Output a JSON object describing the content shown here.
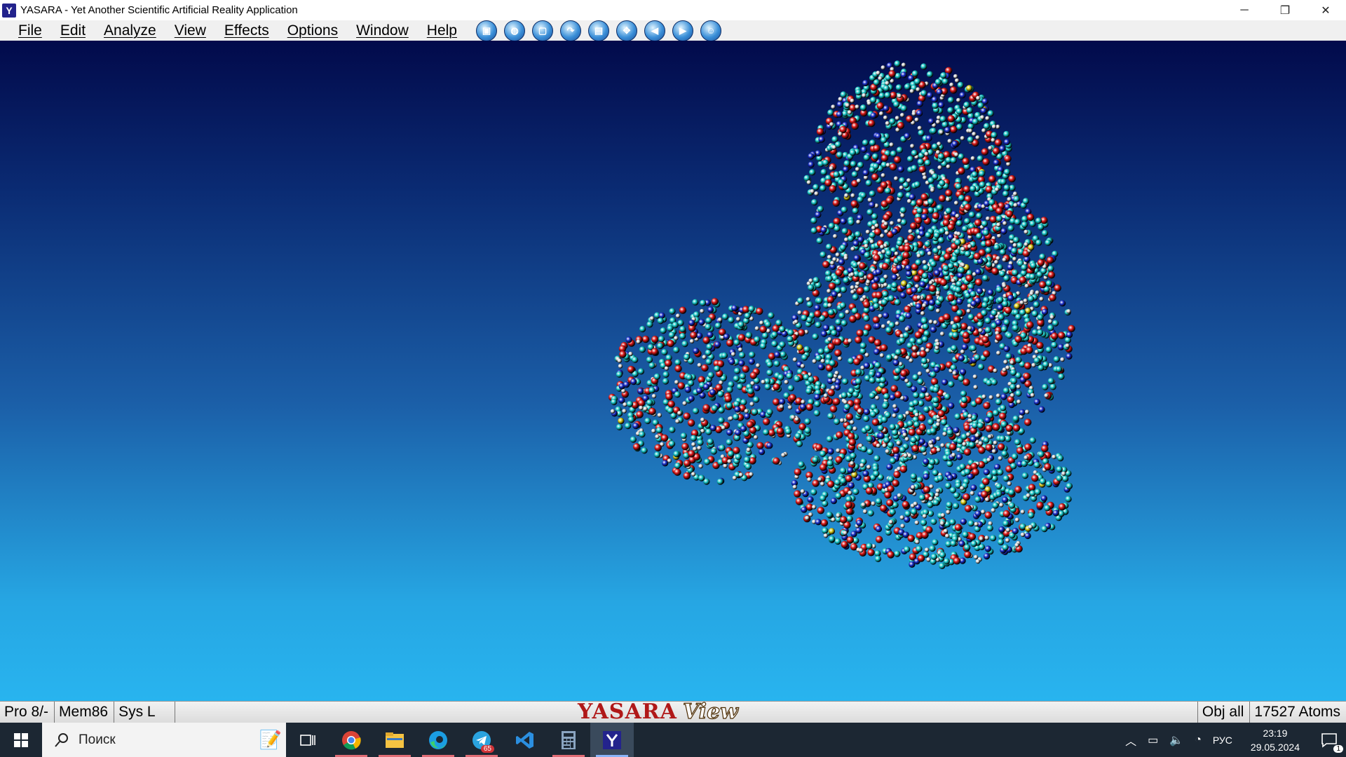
{
  "window": {
    "title": "YASARA - Yet Another Scientific Artificial Reality Application",
    "app_icon_glyph": "Y",
    "controls": [
      "─",
      "❐",
      "✕"
    ]
  },
  "menu": {
    "items": [
      "File",
      "Edit",
      "Analyze",
      "View",
      "Effects",
      "Options",
      "Window",
      "Help"
    ]
  },
  "toolbar": {
    "buttons": [
      "screen-icon",
      "globe-icon",
      "page-icon",
      "redo-icon",
      "save-icon",
      "center-icon",
      "rewind-icon",
      "forward-icon",
      "user-icon"
    ]
  },
  "viewport": {
    "background_top": "#020a4b",
    "background_bottom": "#28b4ef",
    "atom_colors": {
      "carbon": "#19c6c6",
      "oxygen": "#d81818",
      "nitrogen": "#1a2ec8",
      "hydrogen": "#d8d8d8",
      "sulfur": "#d8c818"
    }
  },
  "status": {
    "processors": "Pro 8/-",
    "memory": "Mem86",
    "system": "Sys  L",
    "logo_main": "YASARA",
    "logo_sub": "View",
    "objects": "Obj  all",
    "atoms": "17527 Atoms"
  },
  "taskbar": {
    "search_placeholder": "Поиск",
    "apps": [
      "notes-app",
      "task-view",
      "chrome",
      "file-explorer",
      "edge",
      "telegram",
      "vscode",
      "calculator",
      "yasara"
    ],
    "telegram_badge": "65",
    "language": "РУС",
    "time": "23:19",
    "date": "29.05.2024",
    "notifications": "1"
  }
}
